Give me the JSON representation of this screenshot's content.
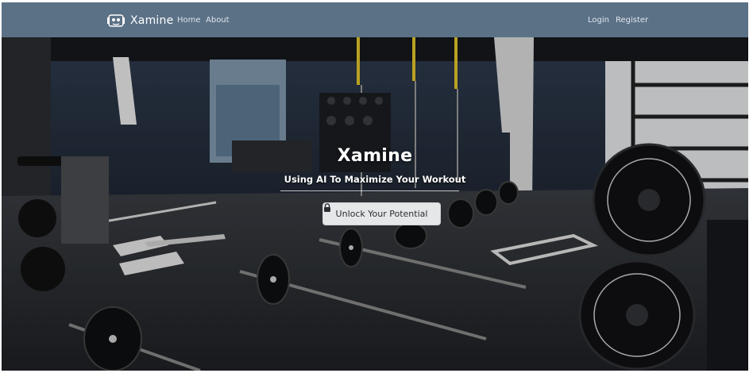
{
  "brand": {
    "name": "Xamine",
    "logo_icon": "dumbbell-logo-icon"
  },
  "nav": {
    "left": [
      {
        "label": "Home"
      },
      {
        "label": "About"
      }
    ],
    "right": [
      {
        "label": "Login"
      },
      {
        "label": "Register"
      }
    ]
  },
  "hero": {
    "title": "Xamine",
    "subtitle": "Using AI To Maximize Your Workout",
    "cta": {
      "label": "Unlock Your Potential",
      "icon": "lock-icon"
    },
    "background": "gym-photo"
  },
  "colors": {
    "navbar": "#5b7186",
    "nav_text": "#dfe6ee",
    "cta_background": "#e6e7e9",
    "cta_text": "#2a2e33"
  }
}
